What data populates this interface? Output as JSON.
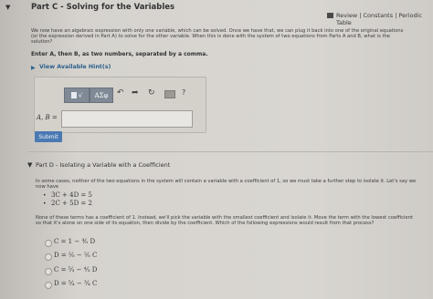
{
  "header": {
    "part_c_title": "Part C - Solving for the Variables",
    "links": "Review | Constants | Periodic Table"
  },
  "part_c": {
    "text1": "We now have an algebraic expression with only one variable, which can be solved. Once we have that, we can plug it back into one of the original equations",
    "text2": "(or the expression derived in Part A) to solve for the other variable. When this is done with the system of two equations from Parts A and B, what is the",
    "text3": "solution?",
    "instruction": "Enter A, then B, as two numbers, separated by a comma.",
    "hints": "View Available Hint(s)",
    "toolbar": {
      "sqrt": "√",
      "greek": "AΣφ",
      "help": "?"
    },
    "answer_label": "A, B =",
    "answer_value": "",
    "submit": "Submit"
  },
  "part_d": {
    "title": "Part D - Isolating a Variable with a Coefficient",
    "text1": "In some cases, neither of the two equations in the system will contain a variable with a coefficient of 1, so we must take a further step to isolate it. Let's say we",
    "text2": "now have",
    "eq1": "3C + 4D = 5",
    "eq2": "2C + 5D = 2",
    "text3": "None of these terms has a coefficient of 1. Instead, we'll pick the variable with the smallest coefficient and isolate it. Move the term with the lowest coefficient",
    "text4": "so that it's alone on one side of its equation, then divide by the coefficient. Which of the following expressions would result from that process?",
    "options": [
      "C = 1 − ⁴⁄₅ D",
      "D = ²⁄₅ − ²⁄₅ C",
      "C = ⁵⁄₃ − ⁴⁄₃ D",
      "D = ⁵⁄₄ − ³⁄₄ C"
    ]
  }
}
